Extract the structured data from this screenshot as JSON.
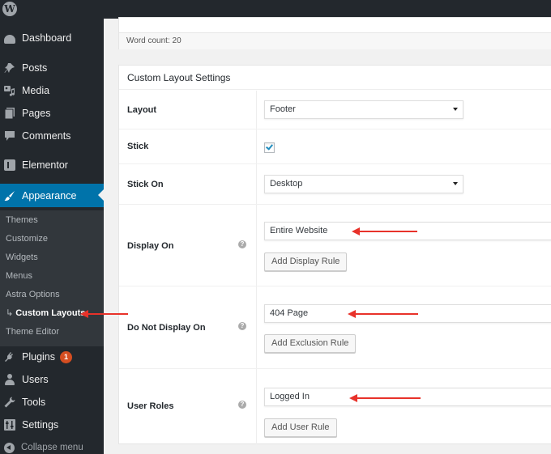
{
  "adminbar": {
    "logo_icon": "wordpress-logo-icon"
  },
  "sidebar": {
    "items": [
      {
        "label": "Dashboard",
        "icon": "dashboard-icon"
      },
      {
        "label": "Posts",
        "icon": "pin-icon"
      },
      {
        "label": "Media",
        "icon": "media-icon"
      },
      {
        "label": "Pages",
        "icon": "pages-icon"
      },
      {
        "label": "Comments",
        "icon": "comment-icon"
      },
      {
        "label": "Elementor",
        "icon": "elementor-icon"
      },
      {
        "label": "Appearance",
        "icon": "paintbrush-icon",
        "active": true
      },
      {
        "label": "Plugins",
        "icon": "plugin-icon",
        "badge": "1"
      },
      {
        "label": "Users",
        "icon": "user-icon"
      },
      {
        "label": "Tools",
        "icon": "wrench-icon"
      },
      {
        "label": "Settings",
        "icon": "settings-icon"
      }
    ],
    "submenu": [
      {
        "label": "Themes"
      },
      {
        "label": "Customize"
      },
      {
        "label": "Widgets"
      },
      {
        "label": "Menus"
      },
      {
        "label": "Astra Options"
      },
      {
        "label": "Custom Layouts",
        "prefix": "↳",
        "current": true
      },
      {
        "label": "Theme Editor"
      }
    ],
    "collapse_label": "Collapse menu"
  },
  "editor": {
    "word_count": "Word count: 20"
  },
  "metabox": {
    "title": "Custom Layout Settings",
    "rows": {
      "layout": {
        "label": "Layout",
        "value": "Footer"
      },
      "stick": {
        "label": "Stick",
        "checked": true
      },
      "stick_on": {
        "label": "Stick On",
        "value": "Desktop"
      },
      "display_on": {
        "label": "Display On",
        "value": "Entire Website",
        "button": "Add Display Rule",
        "help": "?"
      },
      "do_not_display_on": {
        "label": "Do Not Display On",
        "value": "404 Page",
        "button": "Add Exclusion Rule",
        "help": "?"
      },
      "user_roles": {
        "label": "User Roles",
        "value": "Logged In",
        "button": "Add User Rule",
        "help": "?"
      }
    }
  },
  "colors": {
    "sidebar_bg": "#23282d",
    "submenu_bg": "#32373c",
    "active_blue": "#0073aa",
    "badge_orange": "#d54e21",
    "annotation_red": "#e8322a"
  }
}
